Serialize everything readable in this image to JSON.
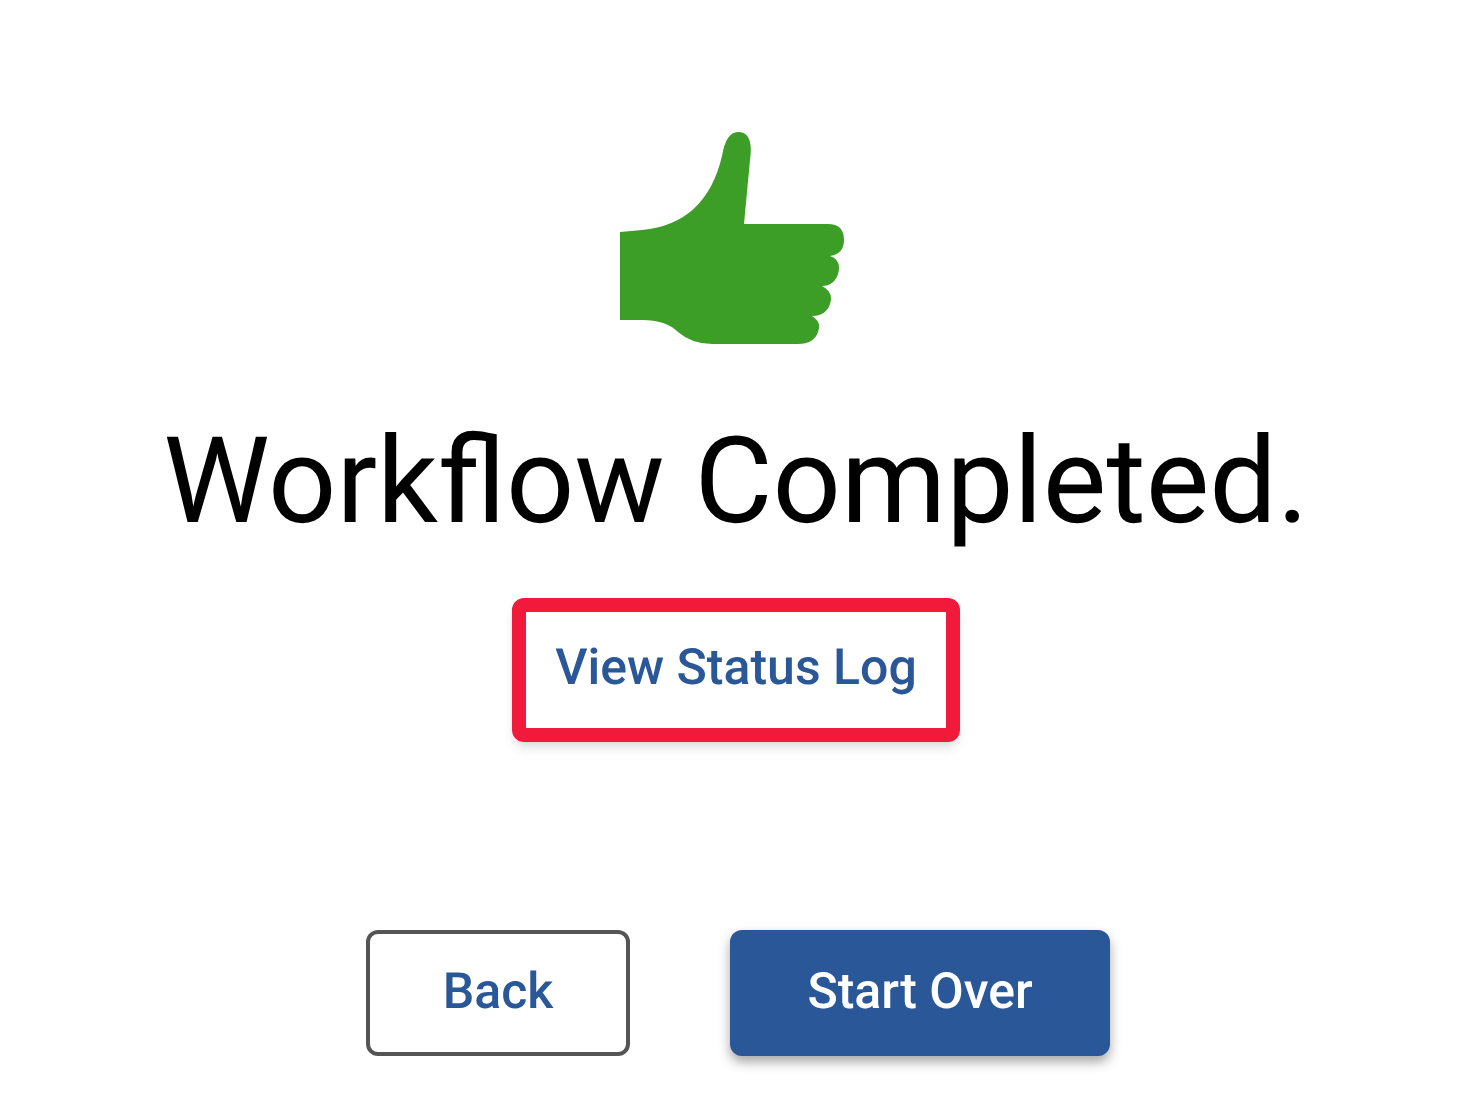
{
  "heading": "Workflow Completed.",
  "status_link": {
    "label": "View Status Log",
    "highlighted": true
  },
  "buttons": [
    {
      "label": "Back",
      "kind": "outline"
    },
    {
      "label": "Start Over",
      "kind": "filled"
    }
  ]
}
